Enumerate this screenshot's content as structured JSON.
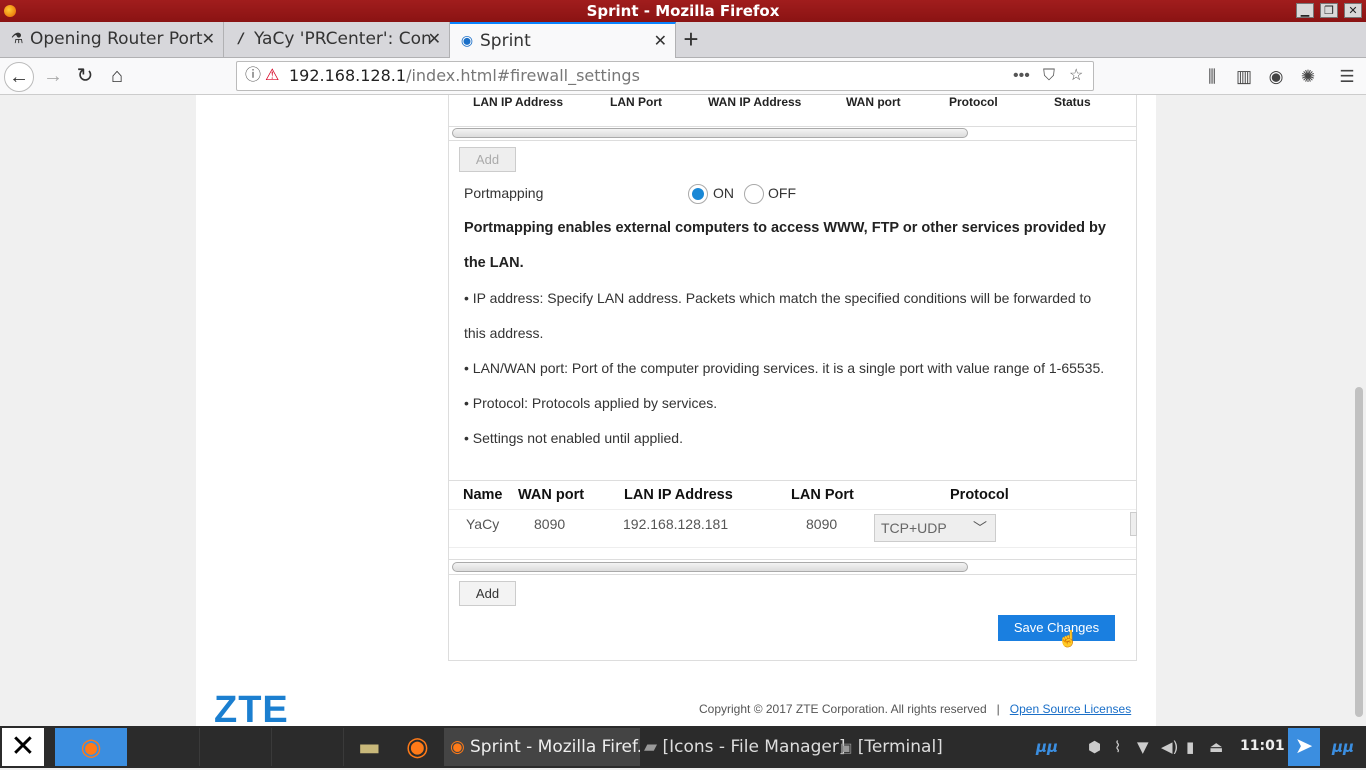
{
  "window": {
    "title": "Sprint - Mozilla Firefox"
  },
  "tabs": [
    {
      "label": "Opening Router Port",
      "icon": "flask-icon"
    },
    {
      "label": "YaCy 'PRCenter': Con",
      "icon": "yacy-icon"
    },
    {
      "label": "Sprint",
      "icon": "globe-icon"
    }
  ],
  "nav": {
    "url_host": "192.168.128.1",
    "url_path": "/index.html#firewall_settings"
  },
  "top_table": {
    "headers": [
      "LAN IP Address",
      "LAN Port",
      "WAN IP Address",
      "WAN port",
      "Protocol",
      "Status"
    ],
    "add_label": "Add"
  },
  "portmapping": {
    "label": "Portmapping",
    "on_label": "ON",
    "off_label": "OFF",
    "selected": "ON",
    "desc_line1": "Portmapping enables external computers to access WWW, FTP or other services provided by",
    "desc_line2": "the LAN.",
    "bullet1_line1": "IP address: Specify LAN address. Packets which match the specified conditions will be forwarded to",
    "bullet1_line2": "this address.",
    "bullet2": "LAN/WAN port: Port of the computer providing services. it is a single port with value range of 1-65535.",
    "bullet3": "Protocol: Protocols applied by services.",
    "bullet4": "Settings not enabled until applied."
  },
  "rules_table": {
    "headers": [
      "Name",
      "WAN port",
      "LAN IP Address",
      "LAN Port",
      "Protocol"
    ],
    "rows": [
      {
        "name": "YaCy",
        "wan_port": "8090",
        "lan_ip": "192.168.128.181",
        "lan_port": "8090",
        "protocol": "TCP+UDP"
      }
    ],
    "add_label": "Add"
  },
  "save_label": "Save Changes",
  "footer": {
    "logo": "ZTE",
    "copyright": "Copyright © 2017 ZTE Corporation. All rights reserved",
    "separator": "|",
    "link": "Open Source Licenses"
  },
  "taskbar": {
    "window_label": "Sprint - Mozilla Firef...",
    "file_manager": "[Icons - File Manager]",
    "terminal": "[Terminal]",
    "clock": "11:01"
  }
}
